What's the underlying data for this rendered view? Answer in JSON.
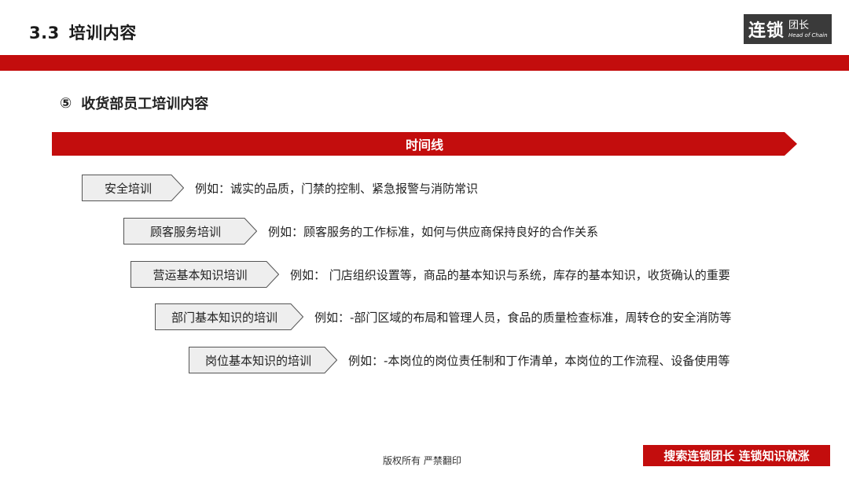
{
  "header": {
    "section_number": "3.3",
    "section_title": "培训内容",
    "logo": {
      "main": "连锁",
      "side": "团长",
      "sub": "Head of Chain"
    }
  },
  "subtitle": {
    "marker": "⑤",
    "text": "收货部员工培训内容"
  },
  "timeline": {
    "label": "时间线"
  },
  "items": [
    {
      "tag": "安全培训",
      "desc": "例如：诚实的品质，门禁的控制、紧急报警与消防常识"
    },
    {
      "tag": "顾客服务培训",
      "desc": "例如：顾客服务的工作标准，如何与供应商保持良好的合作关系"
    },
    {
      "tag": "营运基本知识培训",
      "desc": "例如：  门店组织设置等，商品的基本知识与系统，库存的基本知识，收货确认的重要"
    },
    {
      "tag": "部门基本知识的培训",
      "desc": "例如：-部门区域的布局和管理人员，食品的质量检查标准，周转仓的安全消防等"
    },
    {
      "tag": "岗位基本知识的培训",
      "desc": "例如：-本岗位的岗位责任制和丁作清单，本岗位的工作流程、设备使用等"
    }
  ],
  "footer": {
    "copyright": "版权所有 严禁翻印",
    "slogan": "搜索连锁团长  连锁知识就涨"
  },
  "colors": {
    "accent_red": "#c30d0d",
    "tag_fill": "#eeeeee",
    "tag_border": "#555555"
  }
}
